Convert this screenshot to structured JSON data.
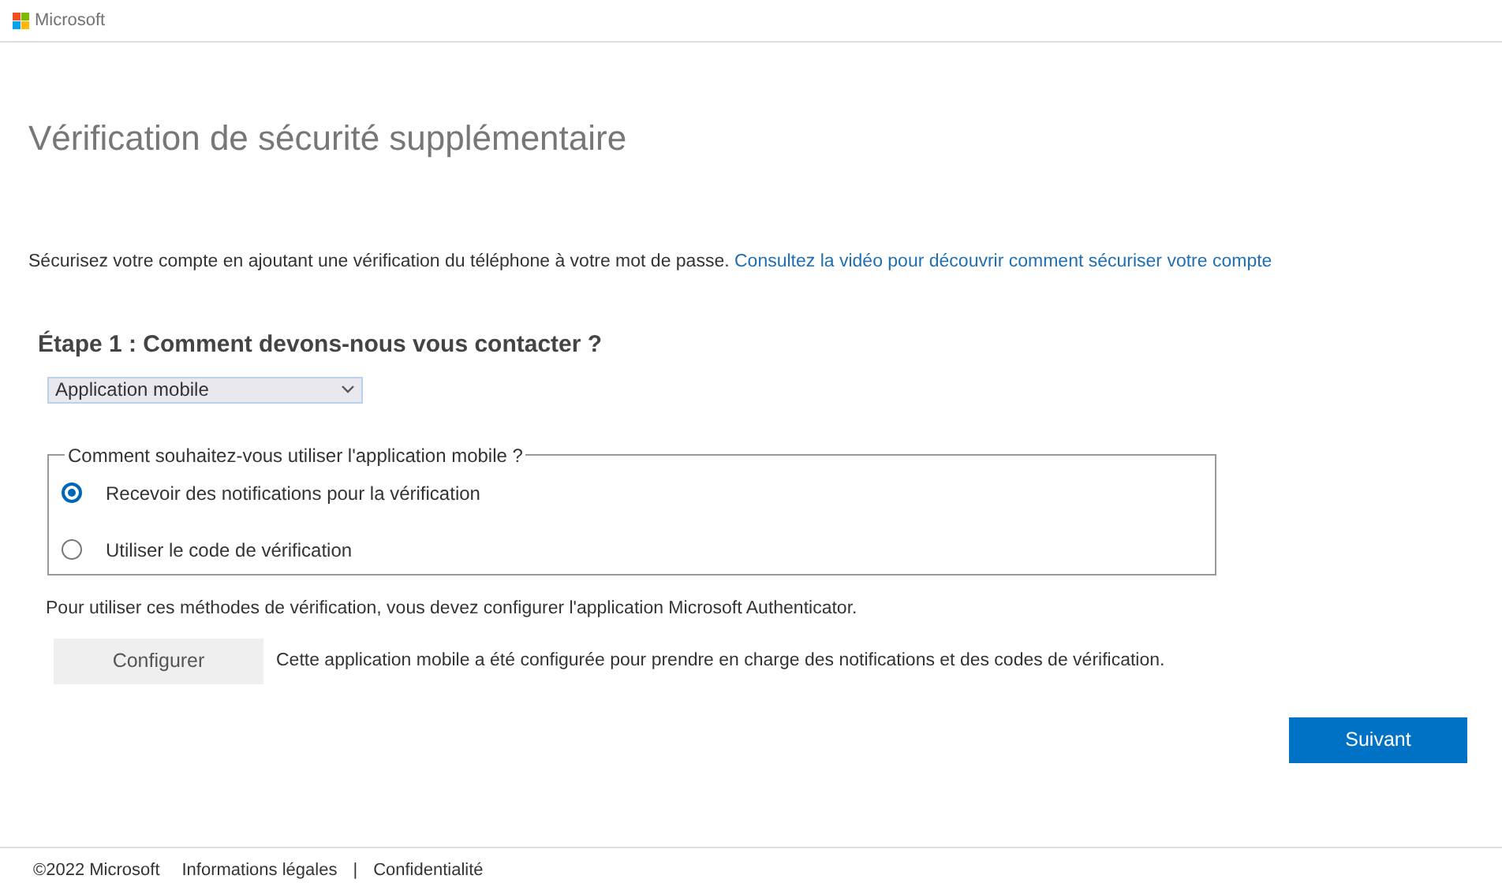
{
  "header": {
    "brand": "Microsoft"
  },
  "title": "Vérification de sécurité supplémentaire",
  "intro": {
    "text": "Sécurisez votre compte en ajoutant une vérification du téléphone à votre mot de passe.",
    "link": "Consultez la vidéo pour découvrir comment sécuriser votre compte"
  },
  "step_heading": "Étape 1 : Comment devons-nous vous contacter ?",
  "contact_select": {
    "value": "Application mobile"
  },
  "usage_group": {
    "legend": "Comment souhaitez-vous utiliser l'application mobile ?",
    "options": [
      {
        "label": "Recevoir des notifications pour la vérification",
        "selected": true
      },
      {
        "label": "Utiliser le code de vérification",
        "selected": false
      }
    ]
  },
  "setup_note": "Pour utiliser ces méthodes de vérification, vous devez configurer l'application Microsoft Authenticator.",
  "configure_button": "Configurer",
  "configure_status": "Cette application mobile a été configurée pour prendre en charge des notifications et des codes de vérification.",
  "next_button": "Suivant",
  "footer": {
    "copyright": "©2022 Microsoft",
    "links": [
      "Informations légales",
      "Confidentialité"
    ],
    "separator": "|"
  }
}
